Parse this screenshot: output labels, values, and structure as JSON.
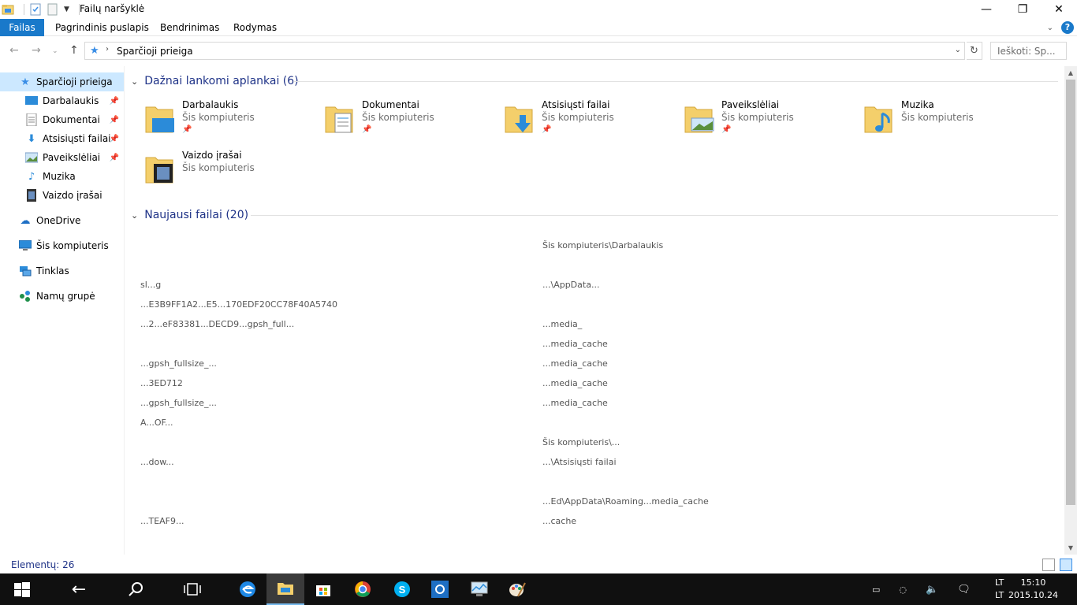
{
  "window": {
    "title": "Failų naršyklė",
    "controls": [
      "minimize",
      "maximize",
      "close"
    ]
  },
  "ribbon": {
    "tabs": [
      {
        "label": "Failas",
        "active": true
      },
      {
        "label": "Pagrindinis puslapis"
      },
      {
        "label": "Bendrinimas"
      },
      {
        "label": "Rodymas"
      }
    ],
    "help": "?"
  },
  "address": {
    "breadcrumb": "Sparčioji prieiga",
    "search_placeholder": "Ieškoti: Sp..."
  },
  "sidebar": {
    "quick_access": "Sparčioji prieiga",
    "pinned": [
      {
        "label": "Darbalaukis",
        "icon": "desktop-icon"
      },
      {
        "label": "Dokumentai",
        "icon": "documents-icon"
      },
      {
        "label": "Atsisiųsti failai",
        "icon": "downloads-icon"
      },
      {
        "label": "Paveikslėliai",
        "icon": "pictures-icon"
      }
    ],
    "unpinned": [
      {
        "label": "Muzika",
        "icon": "music-icon"
      },
      {
        "label": "Vaizdo įrašai",
        "icon": "videos-icon"
      }
    ],
    "roots": [
      {
        "label": "OneDrive",
        "icon": "onedrive-icon"
      },
      {
        "label": "Šis kompiuteris",
        "icon": "computer-icon"
      },
      {
        "label": "Tinklas",
        "icon": "network-icon"
      },
      {
        "label": "Namų grupė",
        "icon": "homegroup-icon"
      }
    ]
  },
  "frequent": {
    "header": "Dažnai lankomi aplankai (6)",
    "folders": [
      {
        "name": "Darbalaukis",
        "location": "Šis kompiuteris",
        "pinned": true
      },
      {
        "name": "Dokumentai",
        "location": "Šis kompiuteris",
        "pinned": true
      },
      {
        "name": "Atsisiųsti failai",
        "location": "Šis kompiuteris",
        "pinned": true
      },
      {
        "name": "Paveikslėliai",
        "location": "Šis kompiuteris",
        "pinned": true
      },
      {
        "name": "Muzika",
        "location": "Šis kompiuteris",
        "pinned": false
      },
      {
        "name": "Vaizdo įrašai",
        "location": "Šis kompiuteris",
        "pinned": false
      }
    ]
  },
  "recent": {
    "header": "Naujausi failai (20)",
    "rows": [
      {
        "name": "",
        "path": "Šis kompiuteris\\Darbalaukis"
      },
      {
        "name": "",
        "path": ""
      },
      {
        "name": "sl...g",
        "path": "...\\AppData..."
      },
      {
        "name": "...E3B9FF1A2...E5...170EDF20CC78F40A5740",
        "path": ""
      },
      {
        "name": "...2...eF83381...DECD9...gpsh_full...",
        "path": "...media_"
      },
      {
        "name": "",
        "path": "...media_cache"
      },
      {
        "name": "...gpsh_fullsize_...",
        "path": "...media_cache"
      },
      {
        "name": "...3ED712",
        "path": "...media_cache"
      },
      {
        "name": "...gpsh_fullsize_...",
        "path": "...media_cache"
      },
      {
        "name": "A...OF...",
        "path": ""
      },
      {
        "name": "",
        "path": "Šis kompiuteris\\..."
      },
      {
        "name": "...dow...",
        "path": "...\\Atsisiųsti failai"
      },
      {
        "name": "",
        "path": ""
      },
      {
        "name": "",
        "path": "...Ed\\AppData\\Roaming...media_cache"
      },
      {
        "name": "...TEAF9...",
        "path": "...cache"
      }
    ]
  },
  "status": {
    "items_count": "Elementų: 26"
  },
  "taskbar": {
    "apps": [
      "start-icon",
      "back-icon",
      "search-icon",
      "task-view-icon",
      "edge-icon",
      "file-explorer-icon",
      "store-icon",
      "chrome-icon",
      "skype-icon",
      "settings-icon",
      "performance-icon",
      "paint-icon"
    ],
    "lang_top": "LT",
    "lang_bottom": "LT",
    "time": "15:10",
    "date": "2015.10.24"
  }
}
